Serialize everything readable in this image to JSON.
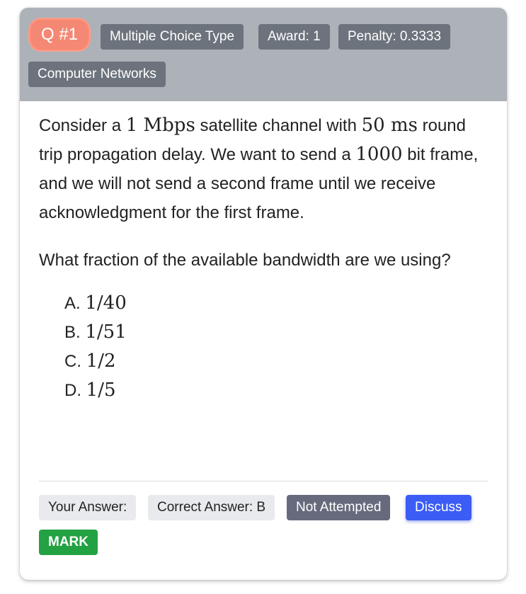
{
  "header": {
    "question_number": "Q #1",
    "type_label": "Multiple Choice Type",
    "award_label": "Award: 1",
    "penalty_label": "Penalty: 0.3333",
    "topic_label": "Computer Networks"
  },
  "question": {
    "p1_a": "Consider a ",
    "p1_m1": "1 Mbps",
    "p1_b": " satellite channel with ",
    "p1_m2": "50 ms",
    "p1_c": " round trip propagation delay. We want to send a ",
    "p1_m3": "1000",
    "p1_d": " bit frame, and we will not send a second frame until we receive acknowledgment for the first frame.",
    "p2": "What fraction of the available bandwidth are we using?"
  },
  "options": [
    {
      "letter": "A. ",
      "value": "1/40"
    },
    {
      "letter": "B. ",
      "value": "1/51"
    },
    {
      "letter": "C. ",
      "value": "1/2"
    },
    {
      "letter": "D. ",
      "value": "1/5"
    }
  ],
  "footer": {
    "your_answer": "Your Answer:",
    "correct_answer": "Correct Answer: B",
    "status": "Not Attempted",
    "discuss": "Discuss",
    "mark": "MARK"
  },
  "colors": {
    "header_bg": "#adb1b8",
    "badge_gray": "#6c737c",
    "question_badge": "#f48874",
    "discuss_blue": "#3b5cf5",
    "mark_green": "#23a243",
    "status_dark": "#666a7c"
  }
}
